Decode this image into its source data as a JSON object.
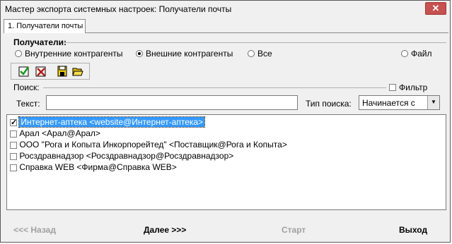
{
  "window": {
    "title": "Мастер экспорта системных настроек: Получатели почты",
    "close_glyph": "✕"
  },
  "tabs": [
    {
      "label": "1. Получатели почты"
    }
  ],
  "recipients": {
    "group_label": "Получатели:",
    "options": [
      {
        "label": "Внутренние контрагенты",
        "selected": false
      },
      {
        "label": "Внешние контрагенты",
        "selected": true
      },
      {
        "label": "Все",
        "selected": false
      },
      {
        "label": "Файл",
        "selected": false
      }
    ]
  },
  "toolbar": {
    "icons": [
      "check-all-icon",
      "uncheck-all-icon",
      "save-icon",
      "open-folder-icon"
    ]
  },
  "search": {
    "group_label": "Поиск:",
    "filter_label": "Фильтр",
    "filter_checked": false,
    "text_label": "Текст:",
    "text_value": "",
    "type_label": "Тип поиска:",
    "type_value": "Начинается с"
  },
  "list": {
    "items": [
      {
        "label": "Интернет-аптека <website@Интернет-аптека>",
        "checked": true,
        "selected": true
      },
      {
        "label": "Арал <Арал@Арал>",
        "checked": false,
        "selected": false
      },
      {
        "label": "ООО \"Рога и Копыта Инкорпорейтед\" <Поставщик@Рога и Копыта>",
        "checked": false,
        "selected": false
      },
      {
        "label": "Росздравнадзор <Росздравнадзор@Росздравнадзор>",
        "checked": false,
        "selected": false
      },
      {
        "label": "Справка WEB <Фирма@Справка WEB>",
        "checked": false,
        "selected": false
      }
    ]
  },
  "footer": {
    "back": "<<< Назад",
    "next": "Далее >>>",
    "start": "Старт",
    "exit": "Выход"
  },
  "colors": {
    "selection": "#3399ff",
    "close": "#c75050"
  }
}
